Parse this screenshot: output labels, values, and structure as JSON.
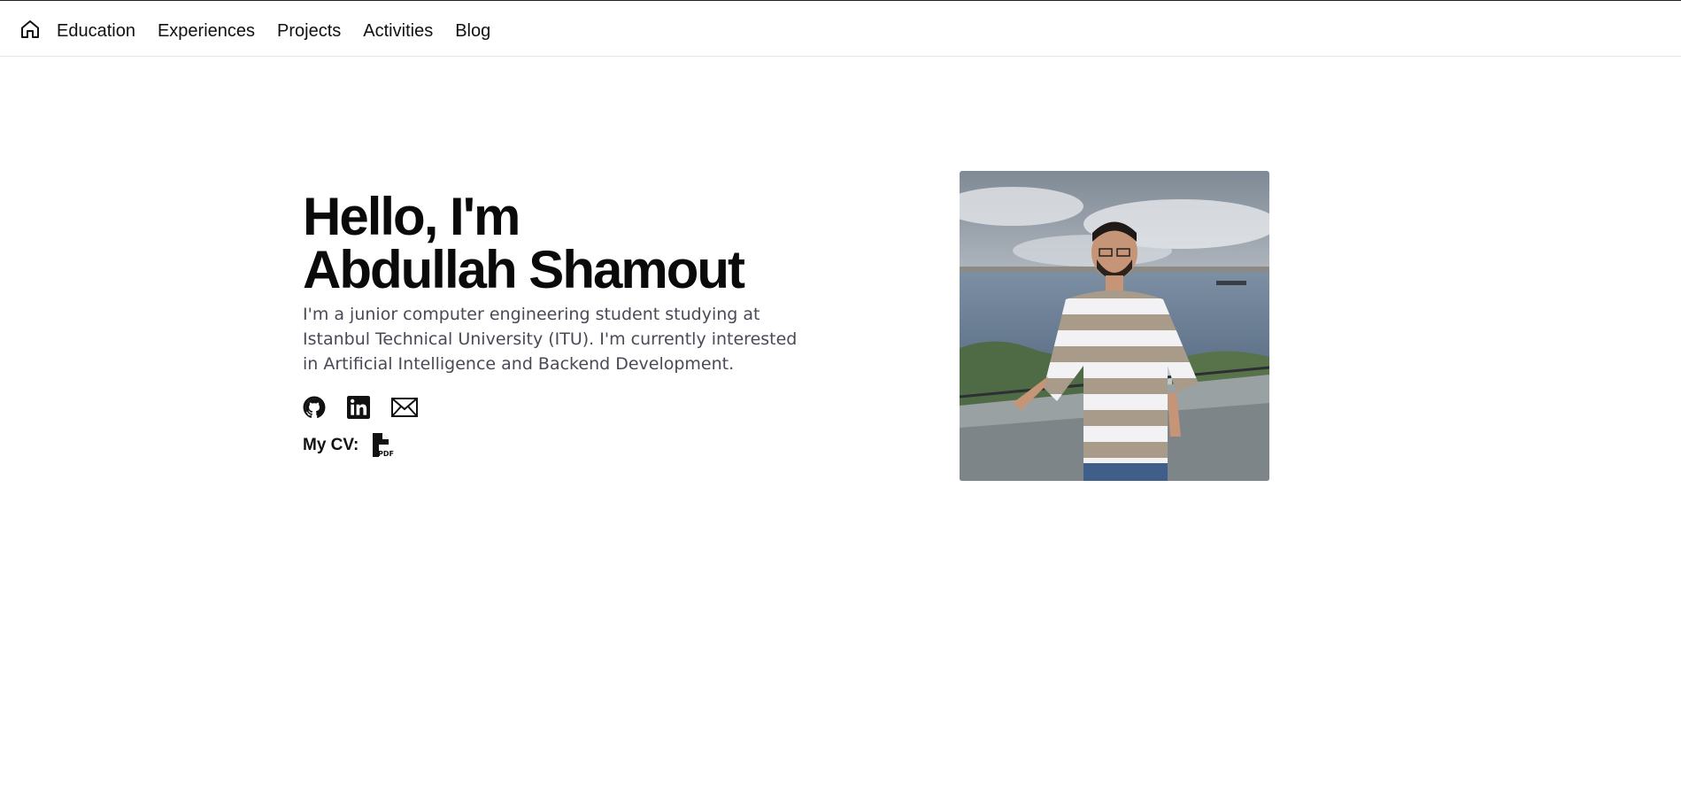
{
  "nav": {
    "home_icon": "home-icon",
    "items": [
      {
        "label": "Education"
      },
      {
        "label": "Experiences"
      },
      {
        "label": "Projects"
      },
      {
        "label": "Activities"
      },
      {
        "label": "Blog"
      }
    ]
  },
  "hero": {
    "greeting": "Hello, I'm",
    "name": "Abdullah Shamout",
    "description": "I'm a junior computer engineering student studying at Istanbul Technical University (ITU). I'm currently interested in Artificial Intelligence and Backend Development.",
    "socials": [
      {
        "icon": "github-icon"
      },
      {
        "icon": "linkedin-icon"
      },
      {
        "icon": "email-icon"
      }
    ],
    "cv_label": "My CV:",
    "cv_icon": "pdf-file-icon"
  },
  "photo": {
    "subject": "profile-photo"
  },
  "colors": {
    "text": "#111111",
    "description": "#4a4a57",
    "background": "#ffffff",
    "divider": "#e5e5e5"
  }
}
